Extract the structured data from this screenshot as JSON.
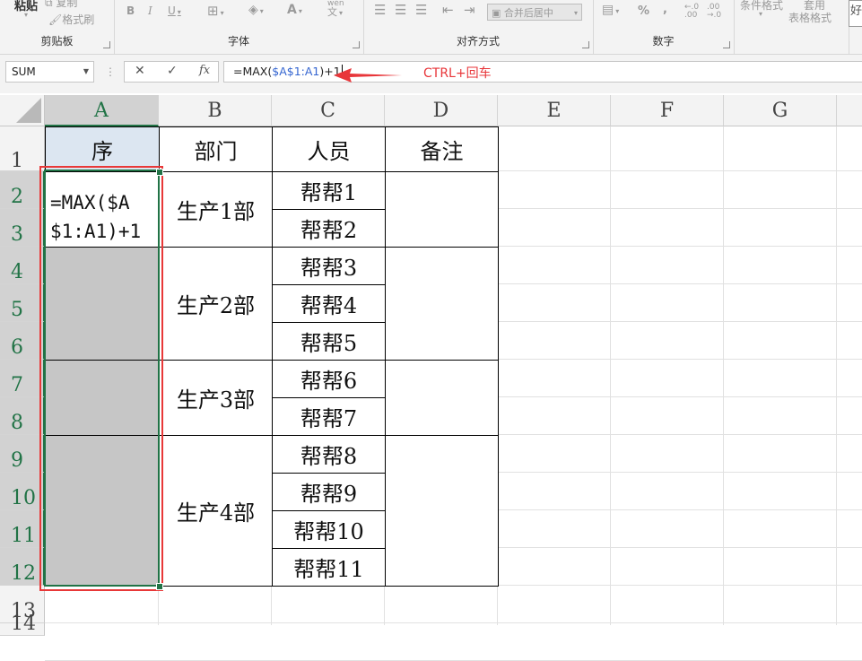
{
  "ribbon": {
    "clipboard": {
      "label": "剪贴板",
      "paste": "粘贴",
      "copy": "复制",
      "format_painter": "格式刷"
    },
    "font": {
      "label": "字体",
      "bold": "B",
      "italic": "I",
      "underline": "U",
      "font_color": "A",
      "wen": "wén",
      "wen2": "文"
    },
    "alignment": {
      "label": "对齐方式",
      "merge": "合并后居中"
    },
    "number": {
      "label": "数字",
      "percent": "%",
      "comma": ",",
      "inc": "←.0 .00",
      "dec": ".00 →.0"
    },
    "styles": {
      "conditional": "条件格式",
      "apply": "套用",
      "table_format": "表格格式",
      "cell": "好"
    }
  },
  "formula_bar": {
    "name_box": "SUM",
    "cancel": "✕",
    "enter": "✓",
    "fx": "fx",
    "formula_prefix": "=MAX(",
    "formula_ref": "$A$1:A1",
    "formula_suffix": ")+1",
    "annotation": "CTRL+回车"
  },
  "columns": [
    "A",
    "B",
    "C",
    "D",
    "E",
    "F",
    "G"
  ],
  "rows": [
    "1",
    "2",
    "3",
    "4",
    "5",
    "6",
    "7",
    "8",
    "9",
    "10",
    "11",
    "12",
    "13",
    "14"
  ],
  "table": {
    "headers": [
      "序",
      "部门",
      "人员",
      "备注"
    ],
    "departments": [
      "生产1部",
      "生产2部",
      "生产3部",
      "生产4部"
    ],
    "people": [
      "帮帮1",
      "帮帮2",
      "帮帮3",
      "帮帮4",
      "帮帮5",
      "帮帮6",
      "帮帮7",
      "帮帮8",
      "帮帮9",
      "帮帮10",
      "帮帮11"
    ],
    "editing_formula": "=MAX($A\n$1:A1)+1"
  },
  "colors": {
    "accent_green": "#217346",
    "highlight_red": "#e83838",
    "ref_blue": "#3465d1"
  }
}
